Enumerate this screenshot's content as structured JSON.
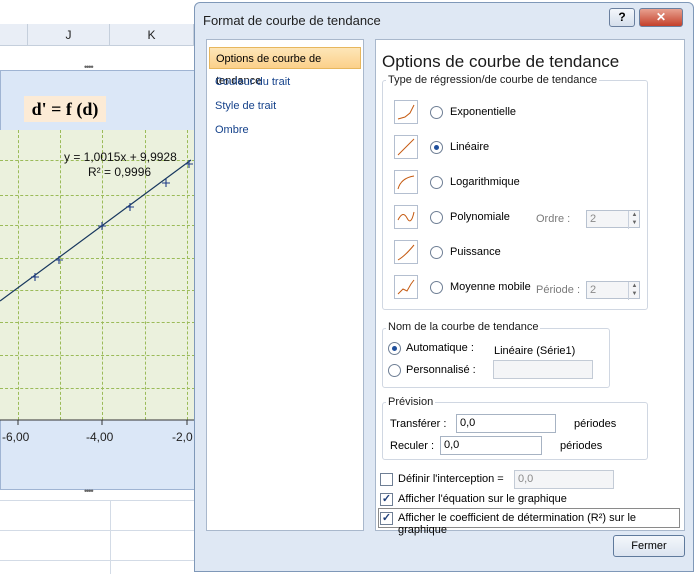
{
  "sheet": {
    "col_j": "J",
    "col_k": "K",
    "chart_title": "d' = f (d)",
    "equation": "y = 1,0015x + 9,9928",
    "r2": "R² = 0,9996",
    "x_ticks": [
      "-6,00",
      "-4,00",
      "-2,0"
    ]
  },
  "dialog": {
    "title": "Format de courbe de tendance",
    "help_label": "?",
    "close_label": "✕",
    "nav": [
      "Options de courbe de tendance",
      "Couleur du trait",
      "Style de trait",
      "Ombre"
    ],
    "heading": "Options de courbe de tendance",
    "regression_group": "Type de régression/de courbe de tendance",
    "types": [
      {
        "label": "Exponentielle",
        "selected": false
      },
      {
        "label": "Linéaire",
        "selected": true
      },
      {
        "label": "Logarithmique",
        "selected": false
      },
      {
        "label": "Polynomiale",
        "selected": false
      },
      {
        "label": "Puissance",
        "selected": false
      },
      {
        "label": "Moyenne mobile",
        "selected": false
      }
    ],
    "ordre_label": "Ordre :",
    "ordre_value": "2",
    "periode_label": "Période :",
    "periode_value": "2",
    "name_group": "Nom de la courbe de tendance",
    "automatique_label": "Automatique :",
    "automatique_value": "Linéaire (Série1)",
    "personnalise_label": "Personnalisé :",
    "personnalise_value": "",
    "prevision_group": "Prévision",
    "transferer_label": "Transférer :",
    "transferer_value": "0,0",
    "reculer_label": "Reculer :",
    "reculer_value": "0,0",
    "periodes_label": "périodes",
    "interception_label": "Définir l'interception =",
    "interception_value": "0,0",
    "afficher_equation_label": "Afficher l'équation sur le graphique",
    "afficher_r2_label": "Afficher le coefficient de détermination (R²) sur le graphique",
    "fermer_label": "Fermer"
  }
}
